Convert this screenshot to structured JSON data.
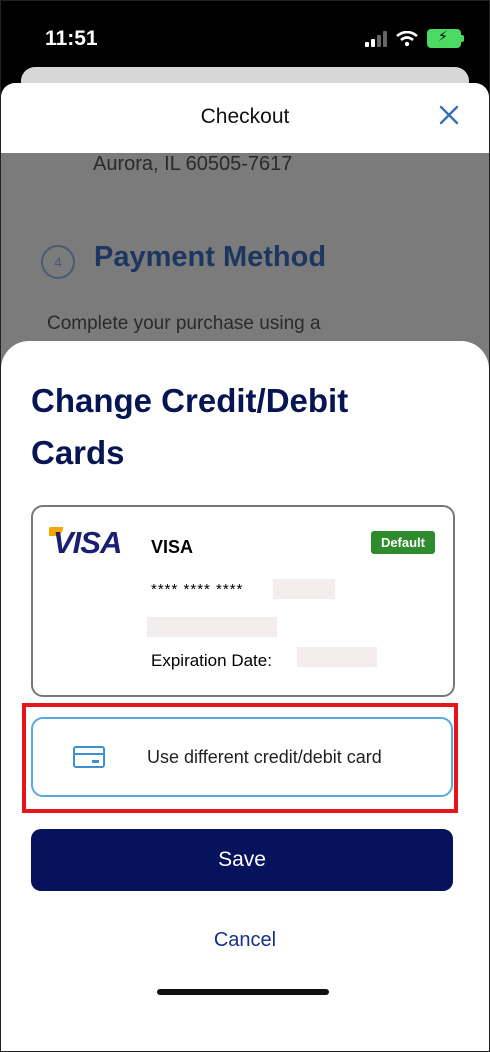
{
  "status_bar": {
    "time": "11:51"
  },
  "sheet": {
    "title": "Checkout",
    "background": {
      "address_line": "Aurora, IL 60505-7617",
      "step_number": "4",
      "section_heading": "Payment Method",
      "section_text": "Complete your purchase using a"
    }
  },
  "modal": {
    "title": "Change Credit/Debit Cards",
    "saved_card": {
      "logo_text": "VISA",
      "brand": "VISA",
      "badge": "Default",
      "masked_number": "**** **** ****",
      "expiration_label": "Expiration Date:"
    },
    "use_different_card_label": "Use different credit/debit card",
    "save_label": "Save",
    "cancel_label": "Cancel"
  },
  "colors": {
    "primary_navy": "#07125c",
    "accent_blue": "#5aa9df",
    "default_badge_green": "#2e8b2e",
    "highlight_red": "#e8141c"
  }
}
